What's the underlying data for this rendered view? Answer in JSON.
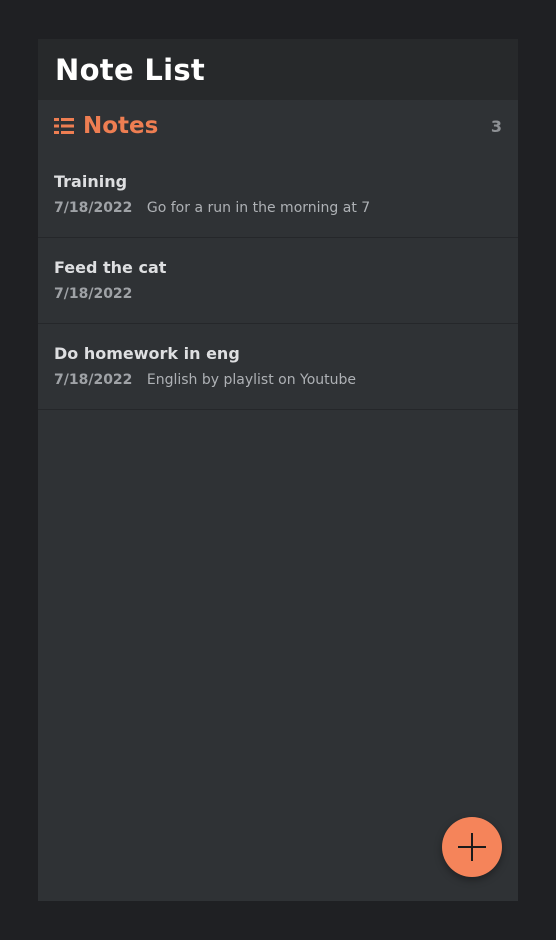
{
  "header": {
    "title": "Note List"
  },
  "section": {
    "title": "Notes",
    "count": "3",
    "icon": "list-icon"
  },
  "notes": [
    {
      "title": "Training",
      "date": "7/18/2022",
      "body": "Go for a run in the morning at 7"
    },
    {
      "title": "Feed the cat",
      "date": "7/18/2022",
      "body": ""
    },
    {
      "title": "Do homework in eng",
      "date": "7/18/2022",
      "body": "English by playlist on Youtube"
    }
  ],
  "fab": {
    "icon": "plus-icon"
  },
  "colors": {
    "page_background": "#1f2023",
    "panel_background": "#2f3235",
    "header_background": "#27292b",
    "accent": "#ee7e52",
    "fab": "#f5845a"
  }
}
